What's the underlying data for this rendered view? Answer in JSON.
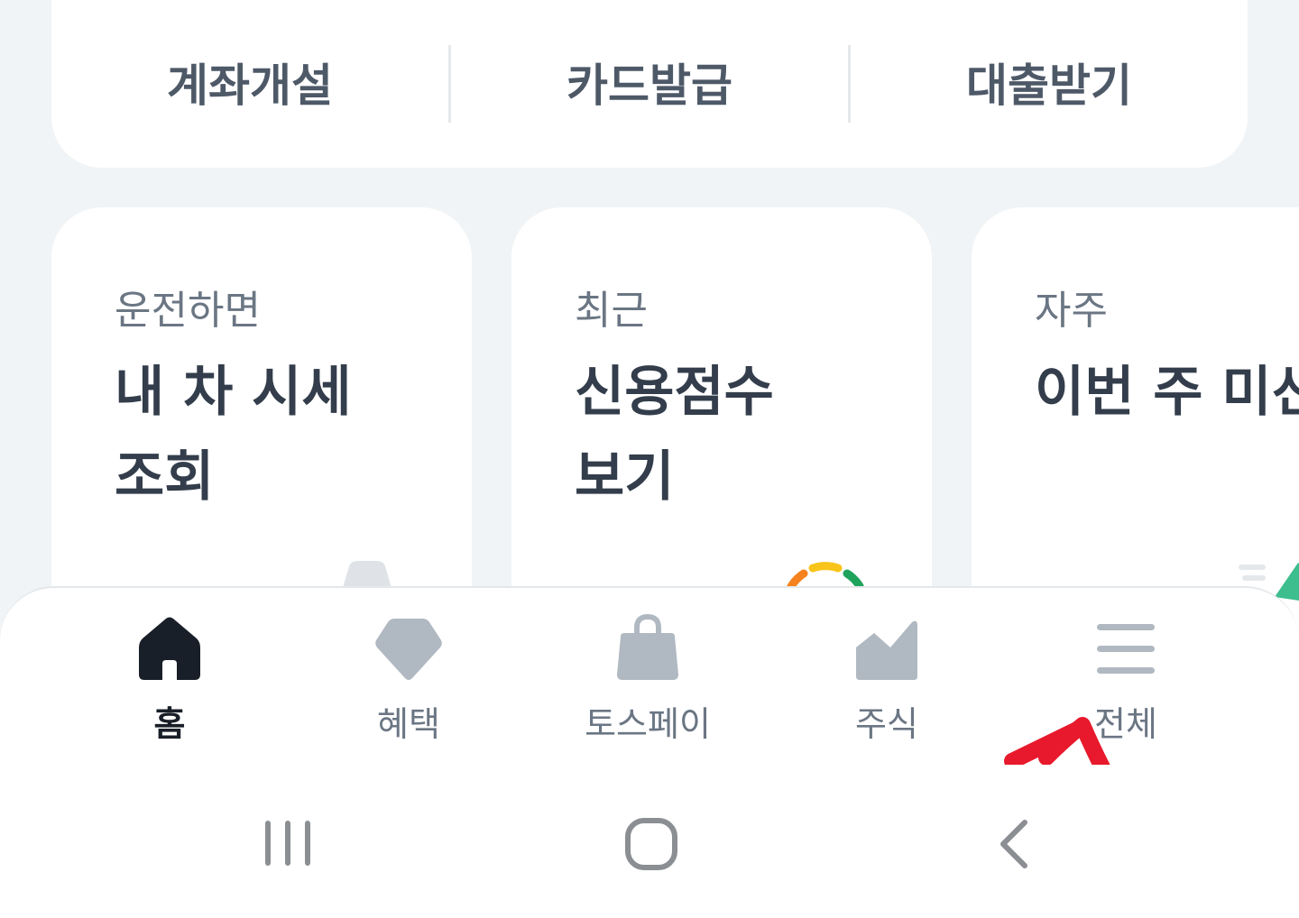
{
  "quick_actions": [
    {
      "label": "계좌개설"
    },
    {
      "label": "카드발급"
    },
    {
      "label": "대출받기"
    }
  ],
  "cards": [
    {
      "eyebrow": "운전하면",
      "title_line1": "내 차 시세",
      "title_line2": "조회"
    },
    {
      "eyebrow": "최근",
      "title_line1": "신용점수",
      "title_line2": "보기"
    },
    {
      "eyebrow": "자주",
      "title_line1": "이번 주 미션",
      "title_line2": ""
    }
  ],
  "bottom_nav": {
    "items": [
      {
        "label": "홈",
        "icon": "home-icon",
        "active": true
      },
      {
        "label": "혜택",
        "icon": "diamond-icon",
        "active": false
      },
      {
        "label": "토스페이",
        "icon": "shopping-bag-icon",
        "active": false
      },
      {
        "label": "주식",
        "icon": "stock-chart-icon",
        "active": false
      },
      {
        "label": "전체",
        "icon": "menu-icon",
        "active": false
      }
    ]
  },
  "system_nav": {
    "recent": "recent-apps-icon",
    "home": "home-button-icon",
    "back": "back-icon"
  },
  "colors": {
    "background": "#f1f4f6",
    "active_icon": "#191f28",
    "inactive_icon": "#b0b8c1",
    "annotation_arrow": "#e8192c"
  }
}
